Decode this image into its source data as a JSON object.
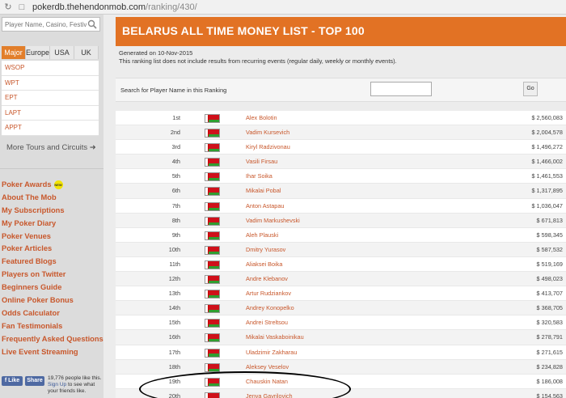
{
  "browser": {
    "url_host": "pokerdb.thehendonmob.com",
    "url_path": "/ranking/430/"
  },
  "sidebar": {
    "search_placeholder": "Player Name, Casino, Festival",
    "tabs": [
      {
        "label": "Major",
        "active": true
      },
      {
        "label": "Europe",
        "active": false
      },
      {
        "label": "USA",
        "active": false
      },
      {
        "label": "UK",
        "active": false
      }
    ],
    "tours": [
      "WSOP",
      "WPT",
      "EPT",
      "LAPT",
      "APPT"
    ],
    "more_tours_label": "More Tours and Circuits",
    "links": [
      {
        "label": "Poker Awards",
        "badge": "NEW"
      },
      {
        "label": "About The Mob"
      },
      {
        "label": "My Subscriptions"
      },
      {
        "label": "My Poker Diary"
      },
      {
        "label": "Poker Venues"
      },
      {
        "label": "Poker Articles"
      },
      {
        "label": "Featured Blogs"
      },
      {
        "label": "Players on Twitter"
      },
      {
        "label": "Beginners Guide"
      },
      {
        "label": "Online Poker Bonus"
      },
      {
        "label": "Odds Calculator"
      },
      {
        "label": "Fan Testimonials"
      },
      {
        "label": "Frequently Asked Questions"
      },
      {
        "label": "Live Event Streaming"
      }
    ],
    "facebook": {
      "like_label": "Like",
      "share_label": "Share",
      "text_before": "19,776 people like this.",
      "signup_label": "Sign Up",
      "text_after": "to see what your friends like."
    }
  },
  "main": {
    "title": "BELARUS ALL TIME MONEY LIST - TOP 100",
    "generated": "Generated on 10-Nov-2015",
    "note": "This ranking list does not include results from recurring events (regular daily, weekly or monthly events).",
    "search_label": "Search for Player Name in this Ranking",
    "go_label": "Go",
    "flag_colors": {
      "red": "#cf101a",
      "green": "#2f9e2f"
    },
    "players": [
      {
        "rank": "1st",
        "name": "Alex Bolotin",
        "money": "$ 2,560,083"
      },
      {
        "rank": "2nd",
        "name": "Vadim Kursevich",
        "money": "$ 2,004,578"
      },
      {
        "rank": "3rd",
        "name": "Kiryl Radzivonau",
        "money": "$ 1,496,272"
      },
      {
        "rank": "4th",
        "name": "Vasili Firsau",
        "money": "$ 1,466,002"
      },
      {
        "rank": "5th",
        "name": "Ihar Soika",
        "money": "$ 1,461,553"
      },
      {
        "rank": "6th",
        "name": "Mikalai Pobal",
        "money": "$ 1,317,895"
      },
      {
        "rank": "7th",
        "name": "Anton Astapau",
        "money": "$ 1,036,047"
      },
      {
        "rank": "8th",
        "name": "Vadim Markushevski",
        "money": "$ 671,813"
      },
      {
        "rank": "9th",
        "name": "Aleh Plauski",
        "money": "$ 598,345"
      },
      {
        "rank": "10th",
        "name": "Dmitry Yurasov",
        "money": "$ 587,532"
      },
      {
        "rank": "11th",
        "name": "Aliaksei Boika",
        "money": "$ 519,169"
      },
      {
        "rank": "12th",
        "name": "Andre Klebanov",
        "money": "$ 498,023"
      },
      {
        "rank": "13th",
        "name": "Artur Rudziankov",
        "money": "$ 413,707"
      },
      {
        "rank": "14th",
        "name": "Andrey Konopelko",
        "money": "$ 368,705"
      },
      {
        "rank": "15th",
        "name": "Andrei Streltsou",
        "money": "$ 320,583"
      },
      {
        "rank": "16th",
        "name": "Mikalai Vaskaboinikau",
        "money": "$ 278,791"
      },
      {
        "rank": "17th",
        "name": "Uladzimir Zakharau",
        "money": "$ 271,615"
      },
      {
        "rank": "18th",
        "name": "Aleksey Veselov",
        "money": "$ 234,828"
      },
      {
        "rank": "19th",
        "name": "Chauskin Natan",
        "money": "$ 186,008"
      },
      {
        "rank": "20th",
        "name": "Jenya Gavrilovich",
        "money": "$ 154,563"
      }
    ]
  }
}
